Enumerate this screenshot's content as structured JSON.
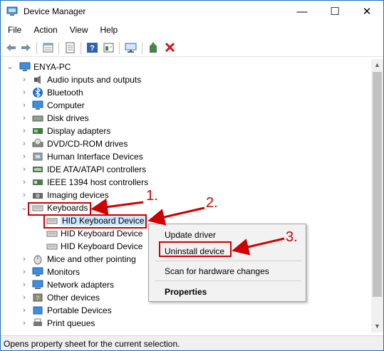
{
  "window": {
    "title": "Device Manager"
  },
  "titlebar": {
    "min_glyph": "—",
    "max_glyph": "☐",
    "close_glyph": "✕"
  },
  "menu": [
    "File",
    "Action",
    "View",
    "Help"
  ],
  "toolbar_icons": [
    "back-arrow-icon",
    "forward-arrow-icon",
    "properties-icon",
    "update-icon",
    "help-icon",
    "view-icon",
    "monitor-icon",
    "add-driver-icon",
    "delete-icon"
  ],
  "tree": {
    "root": "ENYA-PC",
    "categories": [
      {
        "label": "Audio inputs and outputs",
        "icon": "speaker-icon"
      },
      {
        "label": "Bluetooth",
        "icon": "bluetooth-icon"
      },
      {
        "label": "Computer",
        "icon": "computer-icon"
      },
      {
        "label": "Disk drives",
        "icon": "disk-drive-icon"
      },
      {
        "label": "Display adapters",
        "icon": "display-adapter-icon"
      },
      {
        "label": "DVD/CD-ROM drives",
        "icon": "dvd-drive-icon"
      },
      {
        "label": "Human Interface Devices",
        "icon": "hid-icon"
      },
      {
        "label": "IDE ATA/ATAPI controllers",
        "icon": "ide-controller-icon"
      },
      {
        "label": "IEEE 1394 host controllers",
        "icon": "ieee1394-icon"
      },
      {
        "label": "Imaging devices",
        "icon": "camera-icon"
      },
      {
        "label": "Keyboards",
        "icon": "keyboard-icon"
      },
      {
        "label": "Mice and other pointing",
        "icon": "mouse-icon"
      },
      {
        "label": "Monitors",
        "icon": "monitor-icon"
      },
      {
        "label": "Network adapters",
        "icon": "network-icon"
      },
      {
        "label": "Other devices",
        "icon": "other-devices-icon"
      },
      {
        "label": "Portable Devices",
        "icon": "portable-device-icon"
      },
      {
        "label": "Print queues",
        "icon": "printer-icon"
      }
    ],
    "keyboards_children": [
      "HID Keyboard Device",
      "HID Keyboard Device",
      "HID Keyboard Device"
    ]
  },
  "context_menu": {
    "items": [
      "Update driver",
      "Uninstall device",
      "Scan for hardware changes",
      "Properties"
    ]
  },
  "annotations": {
    "step1": "1.",
    "step2": "2.",
    "step3": "3."
  },
  "status": "Opens property sheet for the current selection.",
  "colors": {
    "annotation_red": "#d00000",
    "selection_blue": "#cce8ff"
  }
}
